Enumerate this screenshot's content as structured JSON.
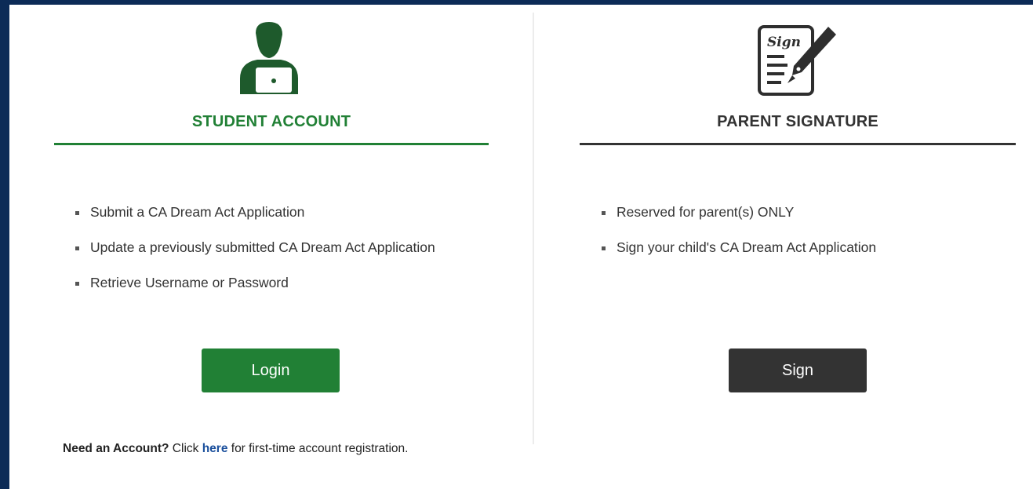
{
  "colors": {
    "frame": "#0c2b57",
    "student_green": "#218035",
    "parent_dark": "#333333",
    "link_blue": "#1a4f9c"
  },
  "student": {
    "icon": "student-laptop-icon",
    "heading": "STUDENT ACCOUNT",
    "bullets": [
      "Submit a CA Dream Act Application",
      "Update a previously submitted CA Dream Act Application",
      "Retrieve Username or Password"
    ],
    "button_label": "Login",
    "need_account": {
      "bold": "Need an Account?",
      "pre": " Click ",
      "link": "here",
      "post": " for first-time account registration."
    }
  },
  "parent": {
    "icon": "sign-document-icon",
    "icon_text": "Sign",
    "heading": "PARENT SIGNATURE",
    "bullets": [
      "Reserved for parent(s) ONLY",
      "Sign your child's CA Dream Act Application"
    ],
    "button_label": "Sign"
  }
}
